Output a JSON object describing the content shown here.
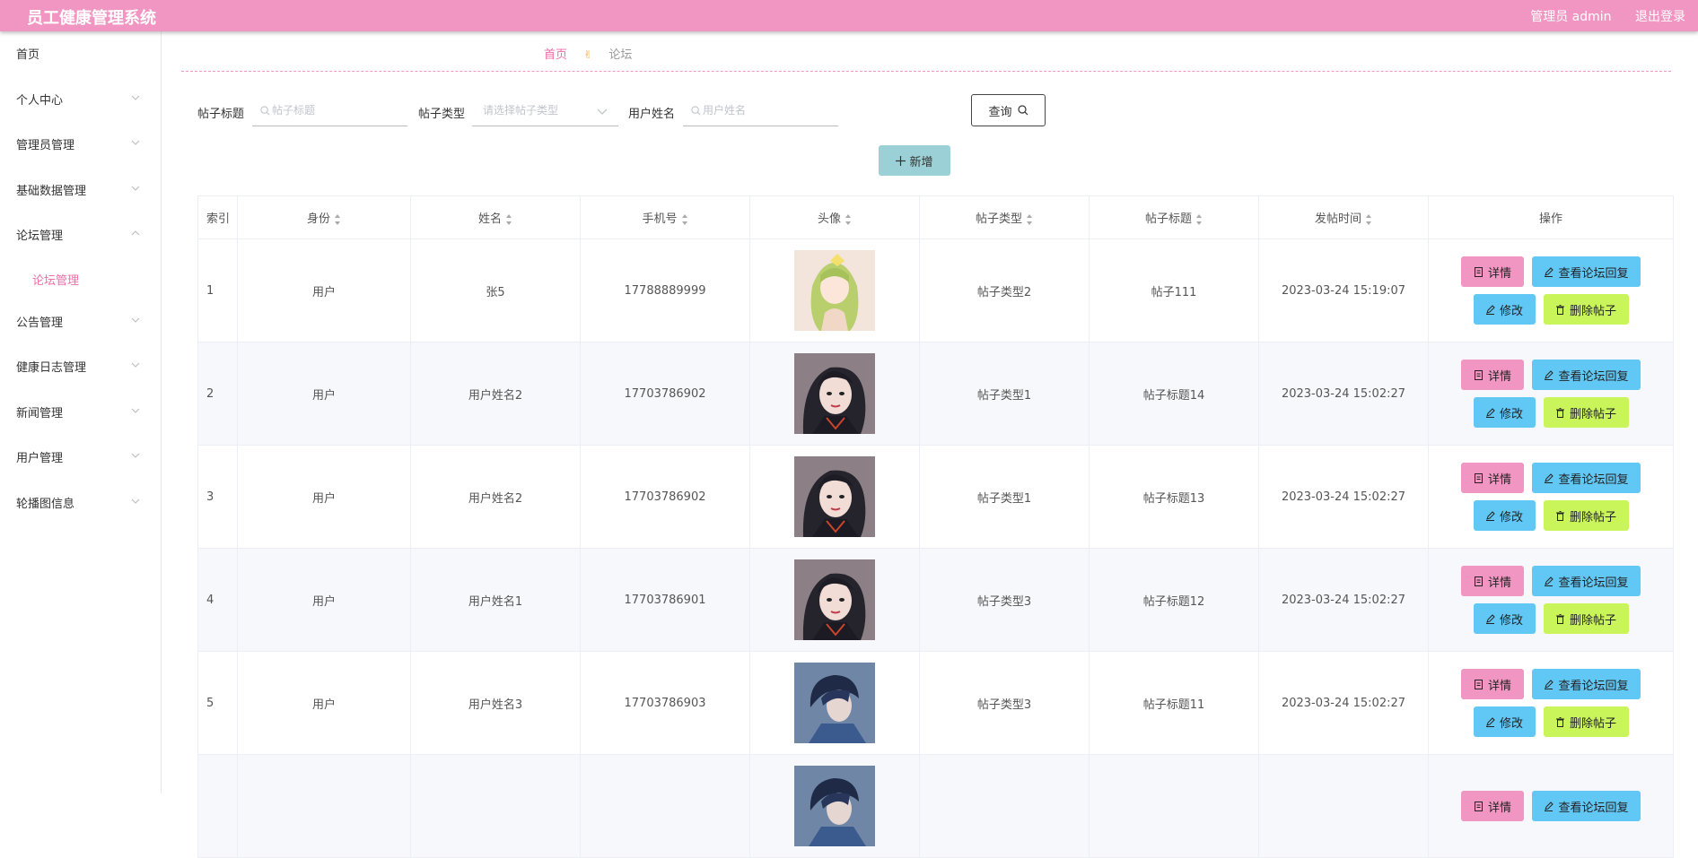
{
  "header": {
    "title": "员工健康管理系统",
    "user": "管理员 admin",
    "logout": "退出登录"
  },
  "colors": {
    "brand": "#f196c2",
    "detail": "#f196c2",
    "reply": "#61c8f5",
    "edit": "#61c8f5",
    "delete": "#c9f55a",
    "add": "#9bd0d6"
  },
  "sidebar": {
    "items": [
      {
        "label": "首页",
        "icon": "none"
      },
      {
        "label": "个人中心",
        "icon": "chevron-down-icon"
      },
      {
        "label": "管理员管理",
        "icon": "chevron-down-icon"
      },
      {
        "label": "基础数据管理",
        "icon": "chevron-down-icon"
      },
      {
        "label": "论坛管理",
        "icon": "chevron-up-icon"
      },
      {
        "label": "论坛管理",
        "icon": "none",
        "sub": true
      },
      {
        "label": "公告管理",
        "icon": "chevron-down-icon"
      },
      {
        "label": "健康日志管理",
        "icon": "chevron-down-icon"
      },
      {
        "label": "新闻管理",
        "icon": "chevron-down-icon"
      },
      {
        "label": "用户管理",
        "icon": "chevron-down-icon"
      },
      {
        "label": "轮播图信息",
        "icon": "chevron-down-icon"
      }
    ]
  },
  "breadcrumb": {
    "home": "首页",
    "separator": "✌",
    "current": "论坛"
  },
  "search": {
    "title_label": "帖子标题",
    "title_placeholder": "帖子标题",
    "type_label": "帖子类型",
    "type_placeholder": "请选择帖子类型",
    "user_label": "用户姓名",
    "user_placeholder": "用户姓名",
    "query_label": "查询"
  },
  "toolbar": {
    "add_label": "新增"
  },
  "table": {
    "columns": [
      "索引",
      "身份",
      "姓名",
      "手机号",
      "头像",
      "帖子类型",
      "帖子标题",
      "发帖时间",
      "操作"
    ],
    "rows": [
      {
        "index": "1",
        "role": "用户",
        "name": "张5",
        "phone": "17788889999",
        "avatar": "anime-girl-green",
        "type": "帖子类型2",
        "title": "帖子111",
        "time": "2023-03-24 15:19:07"
      },
      {
        "index": "2",
        "role": "用户",
        "name": "用户姓名2",
        "phone": "17703786902",
        "avatar": "girl-dark-hair",
        "type": "帖子类型1",
        "title": "帖子标题14",
        "time": "2023-03-24 15:02:27"
      },
      {
        "index": "3",
        "role": "用户",
        "name": "用户姓名2",
        "phone": "17703786902",
        "avatar": "girl-dark-hair",
        "type": "帖子类型1",
        "title": "帖子标题13",
        "time": "2023-03-24 15:02:27"
      },
      {
        "index": "4",
        "role": "用户",
        "name": "用户姓名1",
        "phone": "17703786901",
        "avatar": "girl-dark-hair",
        "type": "帖子类型3",
        "title": "帖子标题12",
        "time": "2023-03-24 15:02:27"
      },
      {
        "index": "5",
        "role": "用户",
        "name": "用户姓名3",
        "phone": "17703786903",
        "avatar": "boy-blue",
        "type": "帖子类型3",
        "title": "帖子标题11",
        "time": "2023-03-24 15:02:27"
      },
      {
        "index": "",
        "role": "",
        "name": "",
        "phone": "",
        "avatar": "boy-blue",
        "type": "",
        "title": "",
        "time": ""
      }
    ],
    "actions": {
      "detail": "详情",
      "reply": "查看论坛回复",
      "edit": "修改",
      "delete": "删除帖子"
    }
  }
}
